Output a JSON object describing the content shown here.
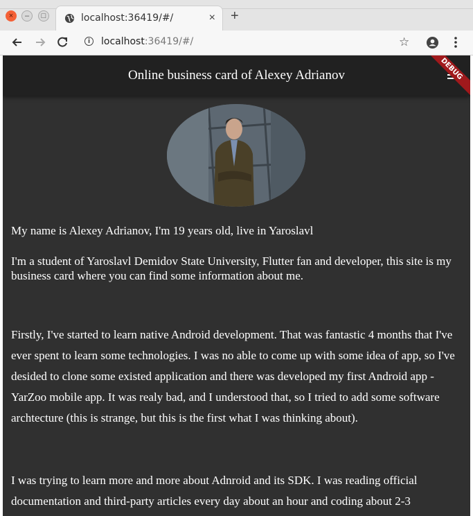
{
  "browser": {
    "tab_title": "localhost:36419/#/",
    "tab_close_glyph": "×",
    "new_tab_glyph": "+",
    "address_host": "localhost",
    "address_rest": ":36419/#/",
    "icons": [
      "close-window-icon",
      "minimize-icon",
      "maximize-icon",
      "globe-icon",
      "back-arrow-icon",
      "forward-arrow-icon",
      "reload-icon",
      "info-icon",
      "bookmark-star-icon",
      "account-icon",
      "kebab-menu-icon"
    ]
  },
  "app": {
    "title": "Online business card of Alexey Adrianov",
    "debug_banner": "DEBUG",
    "colors": {
      "background": "#303030",
      "appbar": "#212121",
      "debug": "#a0191c",
      "text": "#ffffff"
    },
    "paragraphs": {
      "intro": "My name is Alexey Adrianov, I'm 19 years old, live in Yaroslavl",
      "student": "I'm a student of Yaroslavl Demidov State University, Flutter fan and developer, this site is my business card where you can find some information about me.",
      "android": "Firstly, I've started to learn native Android development. That was fantastic 4 months that I've ever spent to learn some technologies. I was no able to come up with some idea of app, so I've desided to clone some existed application and there was developed my first Android app - YarZoo mobile app. It was realy bad, and I understood that, so I tried to add some software archtecture (this is strange, but this is the first what I was thinking about).",
      "sdk": "I was trying to learn more and more about Adnroid and its SDK. I was reading official documentation and third-party articles every day about an hour and coding about 2-3"
    }
  }
}
